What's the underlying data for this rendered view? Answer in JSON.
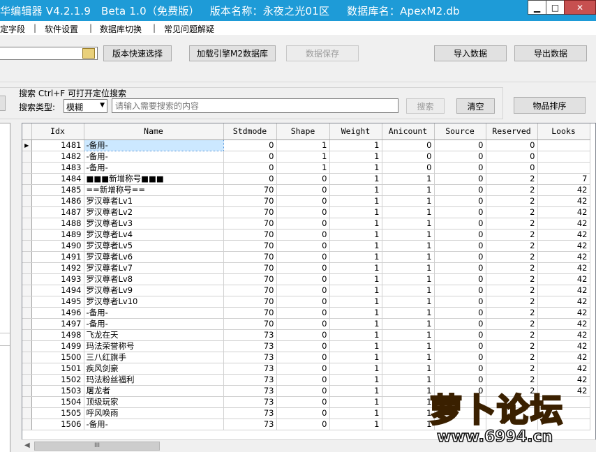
{
  "window": {
    "title": "华编辑器 V4.2.1.9   Beta 1.0（免费版）   版本名称：永夜之光01区     数据库名：ApexM2.db",
    "minimize_glyph": "▁",
    "maximize_glyph": "□",
    "close_glyph": "✕"
  },
  "menu": {
    "items": [
      "定字段",
      "软件设置",
      "数据库切换",
      "常见问题解疑"
    ],
    "separator": "|"
  },
  "toolbar": {
    "version_quick_select": "版本快速选择",
    "load_engine_db": "加载引擎M2数据库",
    "save_data": "数据保存",
    "import_data": "导入数据",
    "export_data": "导出数据"
  },
  "search": {
    "group_label": "搜索  Ctrl+F 可打开定位搜索",
    "type_label": "搜索类型:",
    "type_value": "模糊",
    "placeholder": "请输入需要搜索的内容",
    "search_button": "搜索",
    "clear_button": "清空",
    "sort_button": "物品排序"
  },
  "grid": {
    "columns": [
      "Idx",
      "Name",
      "Stdmode",
      "Shape",
      "Weight",
      "Anicount",
      "Source",
      "Reserved",
      "Looks"
    ],
    "selected_row_indicator": "▶",
    "rows": [
      [
        "1481",
        "-备用-",
        "0",
        "1",
        "1",
        "0",
        "0",
        "0",
        ""
      ],
      [
        "1482",
        "-备用-",
        "0",
        "1",
        "1",
        "0",
        "0",
        "0",
        ""
      ],
      [
        "1483",
        "-备用-",
        "0",
        "1",
        "1",
        "0",
        "0",
        "0",
        ""
      ],
      [
        "1484",
        "■■■新增称号■■■",
        "0",
        "0",
        "1",
        "1",
        "0",
        "2",
        "7"
      ],
      [
        "1485",
        "==新增称号==",
        "70",
        "0",
        "1",
        "1",
        "0",
        "2",
        "42"
      ],
      [
        "1486",
        "罗汉尊者Lv1",
        "70",
        "0",
        "1",
        "1",
        "0",
        "2",
        "42"
      ],
      [
        "1487",
        "罗汉尊者Lv2",
        "70",
        "0",
        "1",
        "1",
        "0",
        "2",
        "42"
      ],
      [
        "1488",
        "罗汉尊者Lv3",
        "70",
        "0",
        "1",
        "1",
        "0",
        "2",
        "42"
      ],
      [
        "1489",
        "罗汉尊者Lv4",
        "70",
        "0",
        "1",
        "1",
        "0",
        "2",
        "42"
      ],
      [
        "1490",
        "罗汉尊者Lv5",
        "70",
        "0",
        "1",
        "1",
        "0",
        "2",
        "42"
      ],
      [
        "1491",
        "罗汉尊者Lv6",
        "70",
        "0",
        "1",
        "1",
        "0",
        "2",
        "42"
      ],
      [
        "1492",
        "罗汉尊者Lv7",
        "70",
        "0",
        "1",
        "1",
        "0",
        "2",
        "42"
      ],
      [
        "1493",
        "罗汉尊者Lv8",
        "70",
        "0",
        "1",
        "1",
        "0",
        "2",
        "42"
      ],
      [
        "1494",
        "罗汉尊者Lv9",
        "70",
        "0",
        "1",
        "1",
        "0",
        "2",
        "42"
      ],
      [
        "1495",
        "罗汉尊者Lv10",
        "70",
        "0",
        "1",
        "1",
        "0",
        "2",
        "42"
      ],
      [
        "1496",
        "-备用-",
        "70",
        "0",
        "1",
        "1",
        "0",
        "2",
        "42"
      ],
      [
        "1497",
        "-备用-",
        "70",
        "0",
        "1",
        "1",
        "0",
        "2",
        "42"
      ],
      [
        "1498",
        "飞龙在天",
        "73",
        "0",
        "1",
        "1",
        "0",
        "2",
        "42"
      ],
      [
        "1499",
        "玛法荣誉称号",
        "73",
        "0",
        "1",
        "1",
        "0",
        "2",
        "42"
      ],
      [
        "1500",
        "三八红旗手",
        "73",
        "0",
        "1",
        "1",
        "0",
        "2",
        "42"
      ],
      [
        "1501",
        "疾风剑豪",
        "73",
        "0",
        "1",
        "1",
        "0",
        "2",
        "42"
      ],
      [
        "1502",
        "玛法粉丝福利",
        "73",
        "0",
        "1",
        "1",
        "0",
        "2",
        "42"
      ],
      [
        "1503",
        "屠龙者",
        "73",
        "0",
        "1",
        "1",
        "0",
        "2",
        "42"
      ],
      [
        "1504",
        "顶级玩家",
        "73",
        "0",
        "1",
        "1",
        "",
        "",
        ""
      ],
      [
        "1505",
        "呼风唤雨",
        "73",
        "0",
        "1",
        "1",
        "",
        "",
        ""
      ],
      [
        "1506",
        "-备用-",
        "73",
        "0",
        "1",
        "1",
        "",
        "",
        ""
      ]
    ]
  },
  "scrollbar": {
    "left_arrow": "◀",
    "thumb_grip": "III"
  },
  "watermark": {
    "text": "萝卜论坛",
    "url": "www.6994.cn"
  }
}
